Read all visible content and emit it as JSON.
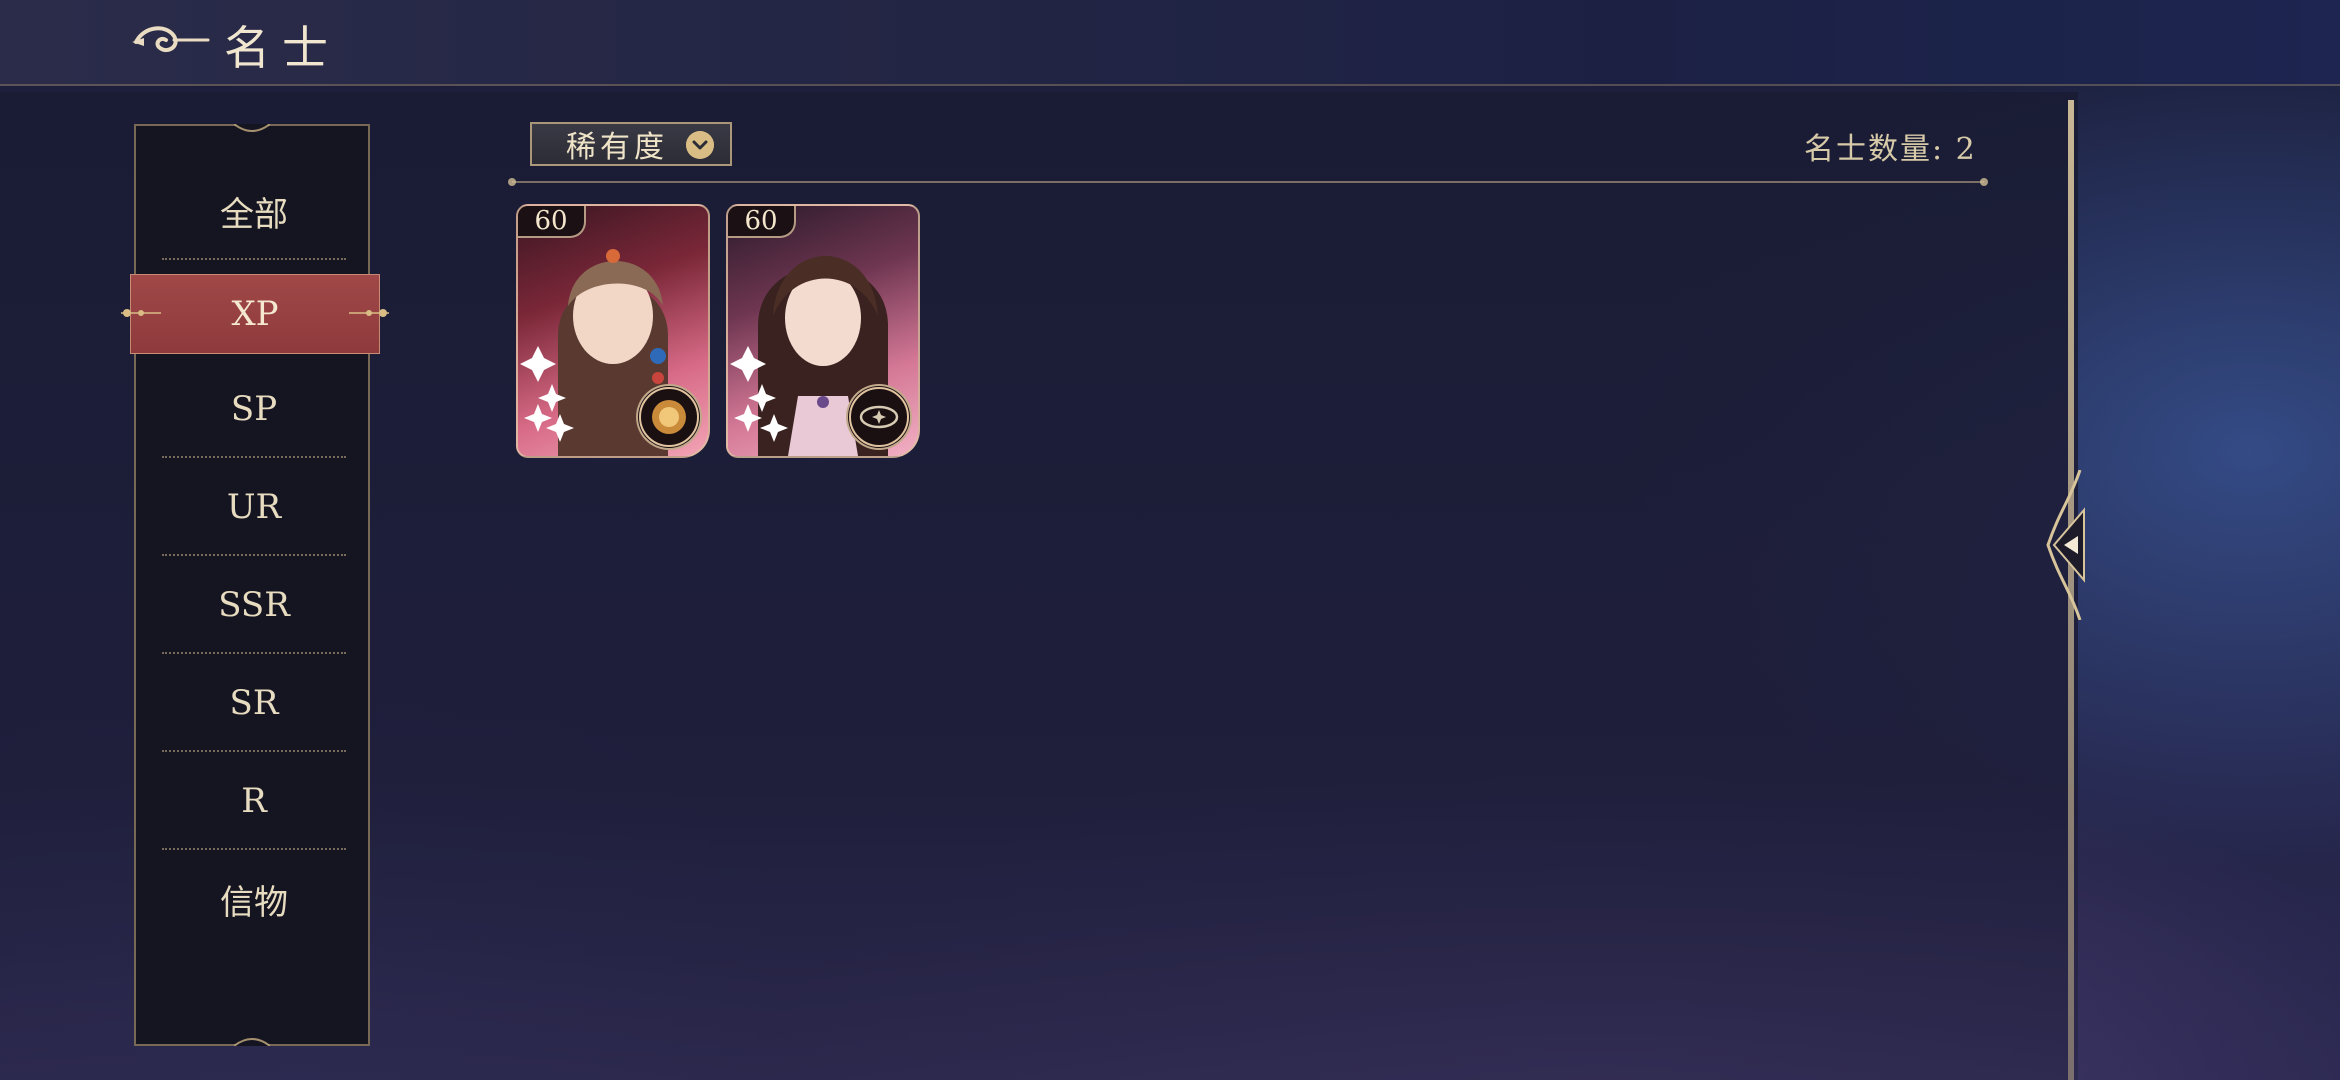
{
  "header": {
    "title": "名士"
  },
  "sidebar": {
    "items": [
      {
        "label": "全部",
        "active": false
      },
      {
        "label": "XP",
        "active": true
      },
      {
        "label": "SP",
        "active": false
      },
      {
        "label": "UR",
        "active": false
      },
      {
        "label": "SSR",
        "active": false
      },
      {
        "label": "SR",
        "active": false
      },
      {
        "label": "R",
        "active": false
      },
      {
        "label": "信物",
        "active": false
      }
    ]
  },
  "filter": {
    "label": "稀有度"
  },
  "count": {
    "label": "名士数量: 2"
  },
  "cards": [
    {
      "level": "60",
      "element_icon": "sun-emblem-icon"
    },
    {
      "level": "60",
      "element_icon": "eye-emblem-icon"
    }
  ],
  "colors": {
    "accent_gold": "#d9bd85",
    "active_tab": "#9a4244",
    "text_cream": "#e8dcc0"
  }
}
